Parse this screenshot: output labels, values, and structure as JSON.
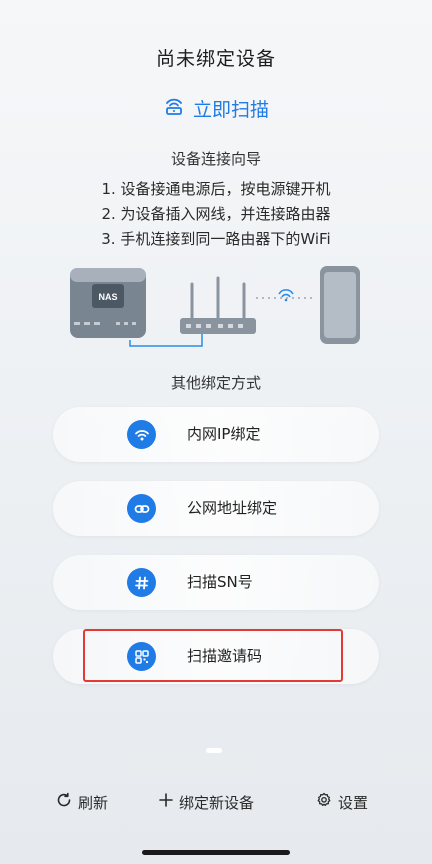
{
  "header": {
    "title": "尚未绑定设备"
  },
  "scan": {
    "label": "立即扫描",
    "icon": "radar-scan-icon"
  },
  "guide": {
    "title": "设备连接向导",
    "steps": [
      "1. 设备接通电源后，按电源键开机",
      "2. 为设备插入网线，并连接路由器",
      "3. 手机连接到同一路由器下的WiFi"
    ],
    "illustration": {
      "device_label": "NAS"
    }
  },
  "other_binding": {
    "title": "其他绑定方式",
    "options": [
      {
        "label": "内网IP绑定",
        "icon": "wifi-icon"
      },
      {
        "label": "公网地址绑定",
        "icon": "link-icon"
      },
      {
        "label": "扫描SN号",
        "icon": "hash-icon"
      },
      {
        "label": "扫描邀请码",
        "icon": "qr-code-icon",
        "highlighted": true
      }
    ]
  },
  "bottom_bar": {
    "refresh": "刷新",
    "add_device": "绑定新设备",
    "settings": "设置"
  },
  "colors": {
    "accent": "#1f7be6",
    "highlight_border": "#e53935"
  }
}
